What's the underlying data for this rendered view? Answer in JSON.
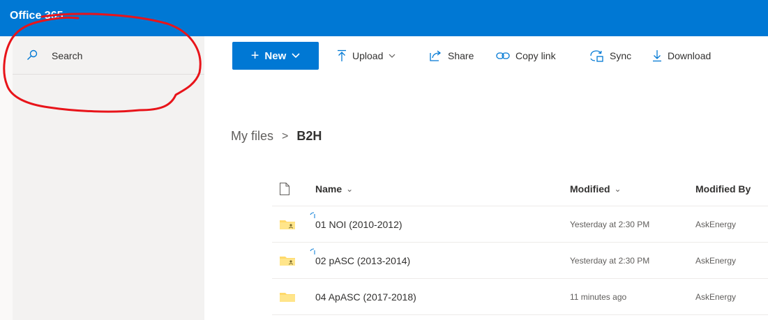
{
  "app": {
    "title": "Office 365"
  },
  "search": {
    "label": "Search"
  },
  "commands": {
    "new_label": "New",
    "upload_label": "Upload",
    "share_label": "Share",
    "copy_link_label": "Copy link",
    "sync_label": "Sync",
    "download_label": "Download"
  },
  "breadcrumb": {
    "root": "My files",
    "current": "B2H"
  },
  "list": {
    "columns": {
      "name": "Name",
      "modified": "Modified",
      "modified_by": "Modified By"
    },
    "rows": [
      {
        "name": "01 NOI (2010-2012)",
        "modified": "Yesterday at 2:30 PM",
        "modified_by": "AskEnergy",
        "shared": true,
        "syncing": true
      },
      {
        "name": "02 pASC (2013-2014)",
        "modified": "Yesterday at 2:30 PM",
        "modified_by": "AskEnergy",
        "shared": true,
        "syncing": true
      },
      {
        "name": "04 ApASC (2017-2018)",
        "modified": "11 minutes ago",
        "modified_by": "AskEnergy",
        "shared": false,
        "syncing": false
      }
    ]
  },
  "colors": {
    "brand": "#0078d4",
    "folder": "#ffd96a",
    "annotation": "#e8141a"
  }
}
